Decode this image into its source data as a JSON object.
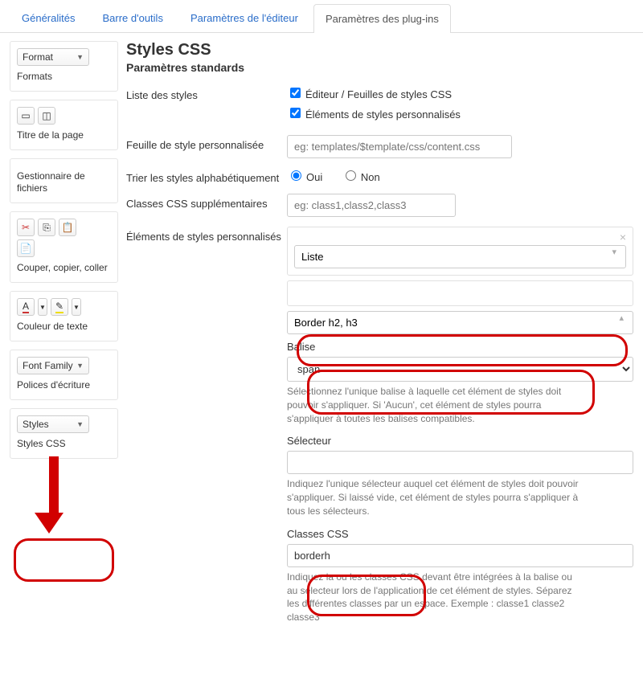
{
  "tabs": {
    "generalites": "Généralités",
    "barre": "Barre d'outils",
    "editeur": "Paramètres de l'éditeur",
    "plugins": "Paramètres des plug-ins"
  },
  "sidebar": {
    "format_sel": "Format",
    "format_label": "Formats",
    "titre_label": "Titre de la page",
    "gestionnaire_label": "Gestionnaire de fichiers",
    "couper_label": "Couper, copier, coller",
    "couleur_label": "Couleur de texte",
    "font_sel": "Font Family",
    "font_label": "Polices d'écriture",
    "styles_sel": "Styles",
    "styles_label": "Styles CSS"
  },
  "main": {
    "title": "Styles CSS",
    "subtitle": "Paramètres standards",
    "liste_label": "Liste des styles",
    "chk1": "Éditeur / Feuilles de styles CSS",
    "chk2": "Éléments de styles personnalisés",
    "feuille_label": "Feuille de style personnalisée",
    "feuille_ph": "eg: templates/$template/css/content.css",
    "trier_label": "Trier les styles alphabétiquement",
    "oui": "Oui",
    "non": "Non",
    "classes_label": "Classes CSS supplémentaires",
    "classes_ph": "eg: class1,class2,class3",
    "elements_label": "Éléments de styles personnalisés",
    "liste_value": "Liste",
    "name_value": "Border h2, h3",
    "balise_label": "Balise",
    "balise_value": "span",
    "balise_help": "Sélectionnez l'unique balise à laquelle cet élément de styles doit pouvoir s'appliquer. Si 'Aucun', cet élément de styles pourra s'appliquer à toutes les balises compatibles.",
    "selecteur_label": "Sélecteur",
    "selecteur_help": "Indiquez l'unique sélecteur auquel cet élément de styles doit pouvoir s'appliquer. Si laissé vide, cet élément de styles pourra s'appliquer à tous les sélecteurs.",
    "css_label": "Classes CSS",
    "css_value": "borderh",
    "css_help": "Indiquez la ou les classes CSS devant être intégrées à la balise ou au sélecteur lors de l'application de cet élément de styles. Séparez les différentes classes par un espace. Exemple : classe1 classe2 classe3"
  }
}
